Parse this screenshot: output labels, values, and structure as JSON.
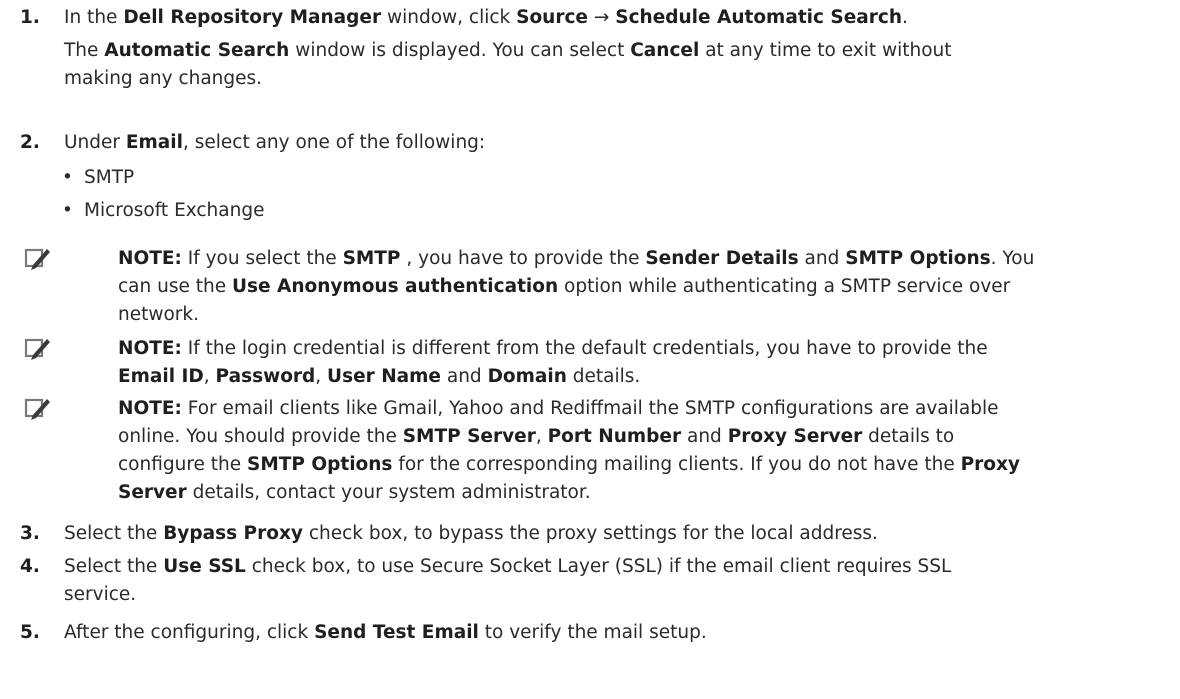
{
  "arrow": "→",
  "step1": {
    "num": "1.",
    "l1_a": "In the ",
    "l1_b": "Dell Repository Manager",
    "l1_c": " window, click ",
    "l1_d": "Source",
    "l1_e": " ",
    "l1_f": " ",
    "l1_g": "Schedule Automatic Search",
    "l1_h": ".",
    "l2_a": "The ",
    "l2_b": "Automatic Search",
    "l2_c": " window is displayed. You can select ",
    "l2_d": "Cancel",
    "l2_e": " at any time to exit without",
    "l3": "making any changes."
  },
  "step2": {
    "num": "2.",
    "a": "Under ",
    "b": "Email",
    "c": ", select any one of the following:",
    "bullets": [
      "SMTP",
      "Microsoft Exchange"
    ]
  },
  "note1": {
    "label": "NOTE:",
    "a": " If you select the ",
    "b": "SMTP",
    "c": " , you have to provide the ",
    "d": "Sender Details",
    "e": " and ",
    "f": "SMTP Options",
    "g": ". You",
    "h": "can use the ",
    "i": "Use Anonymous authentication",
    "j": " option while authenticating a SMTP service over",
    "k": "network."
  },
  "note2": {
    "label": "NOTE:",
    "a": " If the login credential is different from the default credentials, you have to provide the",
    "b": "Email ID",
    "c": ", ",
    "d": "Password",
    "e": ", ",
    "f": "User Name",
    "g": " and ",
    "h": "Domain",
    "i": " details."
  },
  "note3": {
    "label": "NOTE:",
    "a": " For email clients like Gmail, Yahoo and Rediffmail the SMTP configurations are available",
    "b": "online. You should provide the ",
    "c": "SMTP Server",
    "d": ", ",
    "e": "Port Number",
    "f": " and ",
    "g": "Proxy Server",
    "h": " details to",
    "i": "configure the ",
    "j": "SMTP Options",
    "k": " for the corresponding mailing clients. If you do not have the ",
    "l": "Proxy",
    "m": "Server",
    "n": " details, contact your system administrator."
  },
  "step3": {
    "num": "3.",
    "a": "Select the ",
    "b": "Bypass Proxy",
    "c": " check box, to bypass the proxy settings for the local address."
  },
  "step4": {
    "num": "4.",
    "a": "Select the ",
    "b": "Use SSL",
    "c": " check box, to use Secure Socket Layer (SSL) if the email client requires SSL",
    "d": "service."
  },
  "step5": {
    "num": "5.",
    "a": "After the configuring, click ",
    "b": "Send Test Email",
    "c": " to verify the mail setup."
  }
}
